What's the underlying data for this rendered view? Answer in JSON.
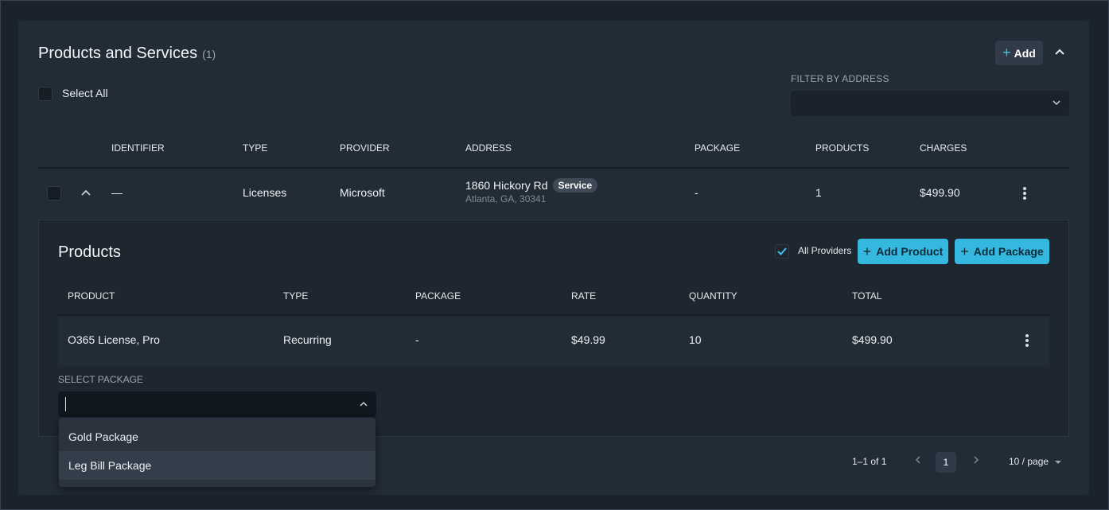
{
  "section": {
    "title": "Products and Services",
    "count": "(1)",
    "add_label": "Add",
    "select_all_label": "Select All",
    "filter_label": "FILTER BY ADDRESS"
  },
  "table": {
    "columns": [
      "IDENTIFIER",
      "TYPE",
      "PROVIDER",
      "ADDRESS",
      "PACKAGE",
      "PRODUCTS",
      "CHARGES"
    ],
    "row": {
      "identifier": "—",
      "type": "Licenses",
      "provider": "Microsoft",
      "address_line1": "1860 Hickory Rd",
      "address_badge": "Service",
      "address_line2": "Atlanta, GA, 30341",
      "package": "-",
      "products": "1",
      "charges": "$499.90"
    }
  },
  "products": {
    "title": "Products",
    "all_providers_label": "All Providers",
    "all_providers_checked": true,
    "add_product_label": "Add Product",
    "add_package_label": "Add Package",
    "columns": [
      "PRODUCT",
      "TYPE",
      "PACKAGE",
      "RATE",
      "QUANTITY",
      "TOTAL"
    ],
    "row": {
      "product": "O365 License, Pro",
      "type": "Recurring",
      "package": "-",
      "rate": "$49.99",
      "quantity": "10",
      "total": "$499.90"
    },
    "select_package_label": "SELECT PACKAGE",
    "package_options": [
      "Gold Package",
      "Leg Bill Package"
    ]
  },
  "pagination": {
    "range": "1–1 of 1",
    "current_page": "1",
    "per_page": "10 / page"
  },
  "colors": {
    "background": "#1a222c",
    "card": "#222c37",
    "accent": "#35b8e0"
  }
}
